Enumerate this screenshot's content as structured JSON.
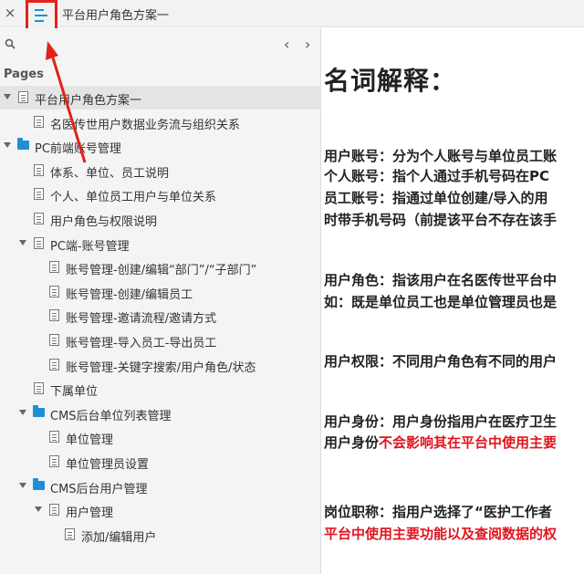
{
  "topbar": {
    "close_label": "×",
    "title": "平台用户角色方案一"
  },
  "sidebar": {
    "pages_label": "Pages",
    "prev_label": "‹",
    "next_label": "›",
    "items": [
      {
        "label": "平台用户角色方案一",
        "type": "page",
        "level": 0,
        "expanded": true,
        "selected": true
      },
      {
        "label": "名医传世用户数据业务流与组织关系",
        "type": "page",
        "level": 1
      },
      {
        "label": "PC前端账号管理",
        "type": "folder",
        "level": 0,
        "expanded": true
      },
      {
        "label": "体系、单位、员工说明",
        "type": "page",
        "level": 1
      },
      {
        "label": "个人、单位员工用户与单位关系",
        "type": "page",
        "level": 1
      },
      {
        "label": "用户角色与权限说明",
        "type": "page",
        "level": 1
      },
      {
        "label": "PC端-账号管理",
        "type": "page",
        "level": 1,
        "expanded": true
      },
      {
        "label": "账号管理-创建/编辑“部门”/“子部门”",
        "type": "page",
        "level": 2
      },
      {
        "label": "账号管理-创建/编辑员工",
        "type": "page",
        "level": 2
      },
      {
        "label": "账号管理-邀请流程/邀请方式",
        "type": "page",
        "level": 2
      },
      {
        "label": "账号管理-导入员工-导出员工",
        "type": "page",
        "level": 2
      },
      {
        "label": "账号管理-关键字搜索/用户角色/状态",
        "type": "page",
        "level": 2
      },
      {
        "label": "下属单位",
        "type": "page",
        "level": 1
      },
      {
        "label": "CMS后台单位列表管理",
        "type": "folder",
        "level": 1,
        "expanded": true
      },
      {
        "label": "单位管理",
        "type": "page",
        "level": 2
      },
      {
        "label": "单位管理员设置",
        "type": "page",
        "level": 2
      },
      {
        "label": "CMS后台用户管理",
        "type": "folder",
        "level": 1,
        "expanded": true
      },
      {
        "label": "用户管理",
        "type": "page",
        "level": 2,
        "expanded": true
      },
      {
        "label": "添加/编辑用户",
        "type": "page",
        "level": 3
      }
    ]
  },
  "content": {
    "heading": "名词解释：",
    "paragraphs": [
      {
        "segments": [
          {
            "text": "用户账号：分为个人账号与单位员工账",
            "red": false
          }
        ]
      },
      {
        "segments": [
          {
            "text": "个人账号：指个人通过手机号码在PC",
            "red": false
          }
        ]
      },
      {
        "segments": [
          {
            "text": "员工账号：指通过单位创建/导入的用",
            "red": false
          }
        ]
      },
      {
        "segments": [
          {
            "text": "时带手机号码（前提该平台不存在该手",
            "red": false
          }
        ]
      },
      {
        "segments": [
          {
            "text": "用户角色：指该用户在名医传世平台中",
            "red": false
          }
        ]
      },
      {
        "segments": [
          {
            "text": "如：既是单位员工也是单位管理员也是",
            "red": false
          }
        ]
      },
      {
        "segments": [
          {
            "text": "用户权限：不同用户角色有不同的用户",
            "red": false
          }
        ]
      },
      {
        "segments": [
          {
            "text": "用户身份：用户身份指用户在医疗卫生",
            "red": false
          }
        ]
      },
      {
        "segments": [
          {
            "text": "用户身份",
            "red": false
          },
          {
            "text": "不会影响其在平台中使用主要",
            "red": true
          }
        ]
      },
      {
        "segments": [
          {
            "text": "岗位职称：指用户选择了“医护工作者",
            "red": false
          }
        ]
      },
      {
        "segments": [
          {
            "text": "平台中使用主要功能以及查阅数据的权",
            "red": true
          }
        ]
      }
    ]
  },
  "colors": {
    "highlight_box": "#e2221a",
    "folder": "#1e8fd6",
    "red_text": "#e0141e"
  },
  "icons": {
    "close": "close-icon",
    "menu": "hamburger-menu-icon",
    "search": "search-icon",
    "page": "page-icon",
    "folder": "folder-icon"
  }
}
